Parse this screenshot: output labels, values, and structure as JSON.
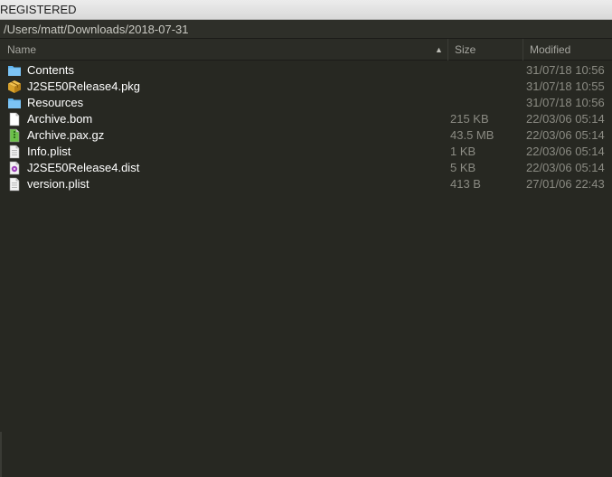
{
  "window": {
    "title": "REGISTERED"
  },
  "path": "/Users/matt/Downloads/2018-07-31",
  "columns": {
    "name": "Name",
    "size": "Size",
    "modified": "Modified"
  },
  "files": [
    {
      "name": "Contents",
      "size": "",
      "modified": "31/07/18 10:56",
      "icon": "folder-icon"
    },
    {
      "name": "J2SE50Release4.pkg",
      "size": "",
      "modified": "31/07/18 10:55",
      "icon": "package-icon"
    },
    {
      "name": "Resources",
      "size": "",
      "modified": "31/07/18 10:56",
      "icon": "folder-icon"
    },
    {
      "name": "Archive.bom",
      "size": "215 KB",
      "modified": "22/03/06 05:14",
      "icon": "document-icon"
    },
    {
      "name": "Archive.pax.gz",
      "size": "43.5 MB",
      "modified": "22/03/06 05:14",
      "icon": "archive-icon"
    },
    {
      "name": "Info.plist",
      "size": "1 KB",
      "modified": "22/03/06 05:14",
      "icon": "plist-icon"
    },
    {
      "name": "J2SE50Release4.dist",
      "size": "5 KB",
      "modified": "22/03/06 05:14",
      "icon": "dist-icon"
    },
    {
      "name": "version.plist",
      "size": "413 B",
      "modified": "27/01/06 22:43",
      "icon": "plist-icon"
    }
  ],
  "colors": {
    "background": "#272822",
    "folder": "#5fb4f0",
    "archive": "#6cc04a",
    "dist": "#9b3fb8",
    "package": "#d9a22b"
  }
}
